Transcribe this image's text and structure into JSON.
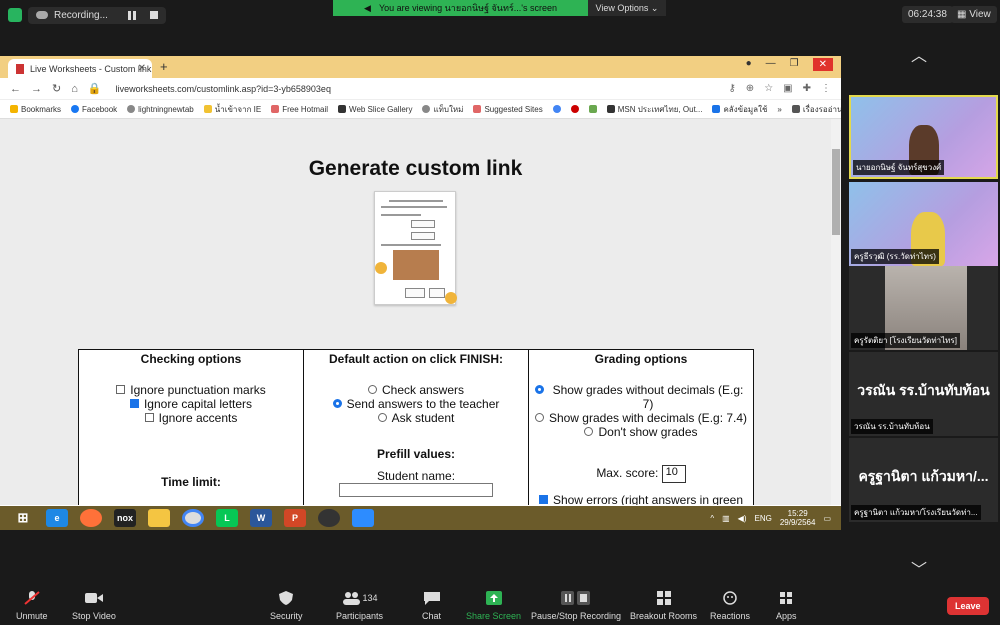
{
  "zoom_top": {
    "recording_label": "Recording...",
    "viewing_text": "You are viewing นายอกนิษฐ์ จันทร์...'s screen",
    "view_options": "View Options",
    "clock": "06:24:38",
    "view_label": "View"
  },
  "browser": {
    "tab_title": "Live Worksheets - Custom link",
    "url": "liveworksheets.com/customlink.asp?id=3-yb658903eq",
    "bookmarks": [
      "Bookmarks",
      "Facebook",
      "lightningnewtab",
      "น้ำเข้าจาก IE",
      "Free Hotmail",
      "Web Slice Gallery",
      "แท็บใหม่",
      "Suggested Sites",
      "MSN ประเทศไทย, Out...",
      "คลังข้อมูลใช้",
      "เรื่องรออ่าน"
    ]
  },
  "page": {
    "title": "Generate custom link",
    "checking": {
      "heading": "Checking options",
      "options": [
        {
          "label": "Ignore punctuation marks",
          "checked": false
        },
        {
          "label": "Ignore capital letters",
          "checked": true
        },
        {
          "label": "Ignore accents",
          "checked": false
        }
      ],
      "time_limit": "Time limit:"
    },
    "default_action": {
      "heading": "Default action on click FINISH:",
      "options": [
        {
          "label": "Check answers",
          "checked": false
        },
        {
          "label": "Send answers to the teacher",
          "checked": true
        },
        {
          "label": "Ask student",
          "checked": false
        }
      ],
      "prefill": "Prefill values:",
      "student_name": "Student name:"
    },
    "grading": {
      "heading": "Grading options",
      "options": [
        {
          "label": "Show grades without decimals (E.g: 7)",
          "checked": true
        },
        {
          "label": "Show grades with decimals (E.g: 7.4)",
          "checked": false
        },
        {
          "label": "Don't show grades",
          "checked": false
        }
      ],
      "max_score_label": "Max. score:",
      "max_score_value": "10",
      "show_errors": "Show errors (right answers in green"
    }
  },
  "taskbar": {
    "lang": "ENG",
    "time": "15:29",
    "date": "29/9/2564"
  },
  "participants": [
    {
      "name": "นายอกนิษฐ์ จันทร์สุขวงศ์",
      "active": true
    },
    {
      "name": "ครูธีรวุฒิ (รร.วัดท่าไทร)",
      "active": false
    },
    {
      "name": "ครูรัตติยา [โรงเรียนวัดท่าไทร]",
      "active": false
    },
    {
      "name": "วรณัน รร.บ้านทับท้อน",
      "big": "วรณัน รร.บ้านทับท้อน",
      "active": false
    },
    {
      "name": "ครูฐานิตา แก้วมหา/โรงเรียนวัดท่า...",
      "big": "ครูฐานิตา แก้วมหา/...",
      "active": false
    }
  ],
  "toolbar": {
    "unmute": "Unmute",
    "stop_video": "Stop Video",
    "security": "Security",
    "participants": "Participants",
    "participants_count": "134",
    "chat": "Chat",
    "share_screen": "Share Screen",
    "recording": "Pause/Stop Recording",
    "breakout": "Breakout Rooms",
    "reactions": "Reactions",
    "apps": "Apps",
    "leave": "Leave"
  }
}
